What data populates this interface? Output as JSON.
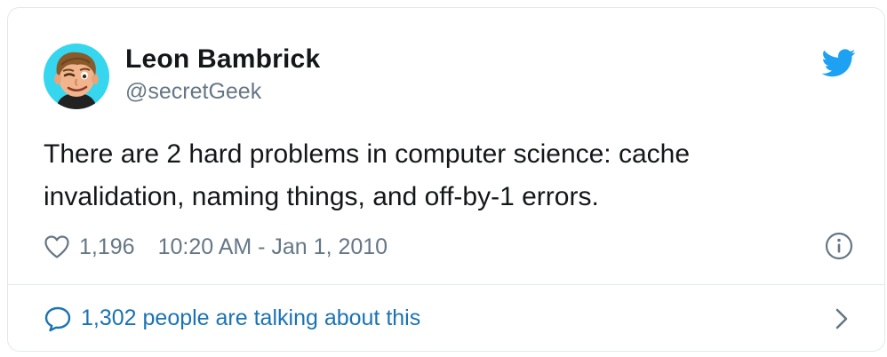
{
  "author": {
    "name": "Leon Bambrick",
    "handle": "@secretGeek",
    "avatar_icon": "avatar-illustration"
  },
  "tweet": {
    "text": "There are 2 hard problems in computer science: cache invalidation, naming things, and off-by-1 errors.",
    "likes": "1,196",
    "timestamp": "10:20 AM - Jan 1, 2010"
  },
  "conversation": {
    "label": "1,302 people are talking about this"
  },
  "icons": {
    "brand": "twitter-bird-icon",
    "like": "heart-icon",
    "info": "info-icon",
    "comment": "speech-bubble-icon",
    "open": "chevron-right-icon"
  },
  "colors": {
    "brand": "#1da1f2",
    "link": "#1b73b3",
    "muted": "#657786",
    "text": "#14171a",
    "border": "#e1e8ed"
  }
}
